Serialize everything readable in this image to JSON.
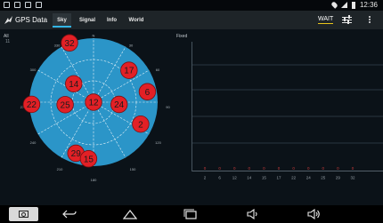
{
  "status_bar": {
    "time": "12:36"
  },
  "app": {
    "title": "GPS Data"
  },
  "tabs": [
    {
      "label": "Sky",
      "selected": true
    },
    {
      "label": "Signal",
      "selected": false
    },
    {
      "label": "Info",
      "selected": false
    },
    {
      "label": "World",
      "selected": false
    }
  ],
  "actions": {
    "wait_label": "WAIT",
    "tune_icon": "tune-icon",
    "more_icon": "more-vert-icon"
  },
  "sky": {
    "panel_label": "All",
    "count": "11",
    "compass": {
      "north": "N",
      "deg30": "30",
      "deg60": "60",
      "deg90": "90",
      "deg120": "120",
      "deg150": "150",
      "deg180": "180",
      "deg210": "210",
      "deg240": "240",
      "deg270": "270",
      "deg300": "300",
      "deg330": "330"
    },
    "satellites": [
      {
        "prn": "32",
        "azimuth": 338,
        "elevation": 0,
        "color": "#e22026"
      },
      {
        "prn": "17",
        "azimuth": 48,
        "elevation": 23,
        "color": "#e22026"
      },
      {
        "prn": "14",
        "azimuth": 313,
        "elevation": 52,
        "color": "#e22026"
      },
      {
        "prn": "6",
        "azimuth": 79,
        "elevation": 13,
        "color": "#e22026"
      },
      {
        "prn": "12",
        "azimuth": 0,
        "elevation": 90,
        "color": "#e22026"
      },
      {
        "prn": "25",
        "azimuth": 265,
        "elevation": 50,
        "color": "#e22026"
      },
      {
        "prn": "24",
        "azimuth": 95,
        "elevation": 54,
        "color": "#e22026"
      },
      {
        "prn": "22",
        "azimuth": 268,
        "elevation": 3,
        "color": "#e22026"
      },
      {
        "prn": "2",
        "azimuth": 115,
        "elevation": 17,
        "color": "#e22026"
      },
      {
        "prn": "29",
        "azimuth": 199,
        "elevation": 14,
        "color": "#e22026"
      },
      {
        "prn": "15",
        "azimuth": 185,
        "elevation": 10,
        "color": "#e22026"
      }
    ]
  },
  "signal": {
    "panel_label": "Fixed",
    "prns": [
      "2",
      "6",
      "12",
      "14",
      "15",
      "17",
      "22",
      "24",
      "25",
      "29",
      "32"
    ],
    "snr": [
      "0",
      "0",
      "0",
      "0",
      "0",
      "0",
      "0",
      "0",
      "0",
      "0",
      "0"
    ],
    "colors": {
      "grid": "#4a5a66",
      "value": "#c53a3a",
      "label": "#9aa3aa"
    }
  },
  "colors": {
    "sky_disc": "#2b95c8",
    "grid_line": "#e6f2f8",
    "actionbar": "#1e2428",
    "accent": "#33b5e5"
  },
  "navbar": {
    "items": [
      "screenshot-icon",
      "back-icon",
      "home-icon",
      "recents-icon",
      "volume-down-icon",
      "volume-up-icon"
    ]
  }
}
